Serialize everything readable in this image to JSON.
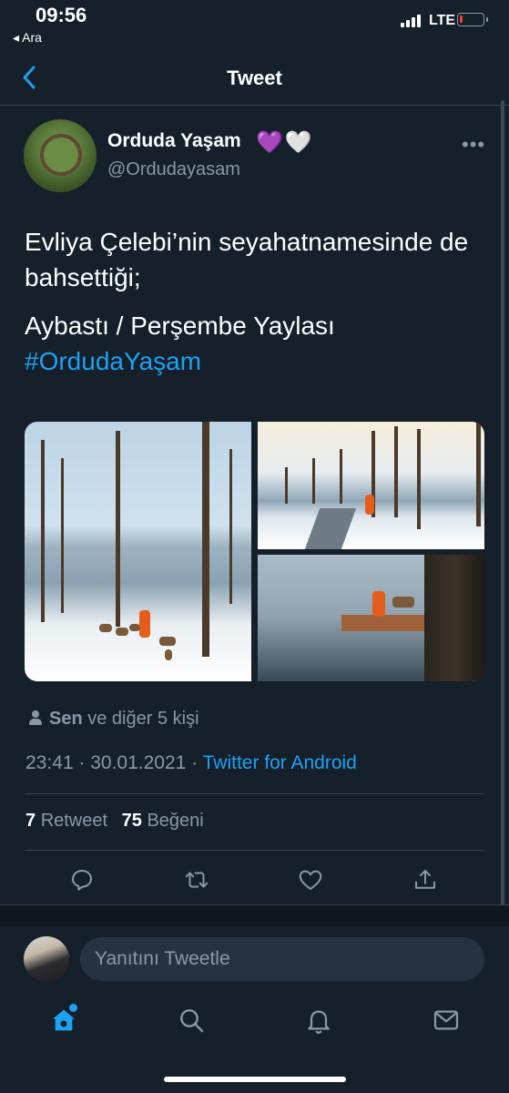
{
  "status_bar": {
    "time": "09:56",
    "back_app": "◂ Ara",
    "network": "LTE"
  },
  "header": {
    "title": "Tweet"
  },
  "tweet": {
    "display_name": "Orduda Yaşam",
    "name_emojis": [
      "💜",
      "🤍"
    ],
    "handle": "@Ordudayasam",
    "text_line1": "Evliya Çelebi’nin seyahatnamesinde de bahsettiği;",
    "text_line2": "Aybastı / Perşembe Yaylası",
    "hashtag": "#OrdudaYaşam",
    "liked_by_you": "Sen",
    "liked_by_rest": "ve diğer 5 kişi",
    "timestamp": "23:41 · 30.01.2021 · ",
    "source": "Twitter for Android",
    "retweet_count": "7",
    "retweet_label": "Retweet",
    "like_count": "75",
    "like_label": "Beğeni"
  },
  "reply": {
    "placeholder": "Yanıtını Tweetle"
  },
  "icons": {
    "back": "chevron-left-icon",
    "more": "more-icon",
    "reply": "comment-icon",
    "retweet": "retweet-icon",
    "like": "heart-icon",
    "share": "share-icon",
    "home": "home-icon",
    "search": "search-icon",
    "notifications": "bell-icon",
    "messages": "mail-icon"
  },
  "colors": {
    "background": "#15202b",
    "accent": "#1da1f2",
    "secondary_text": "#8899a6",
    "divider": "#38444d"
  }
}
